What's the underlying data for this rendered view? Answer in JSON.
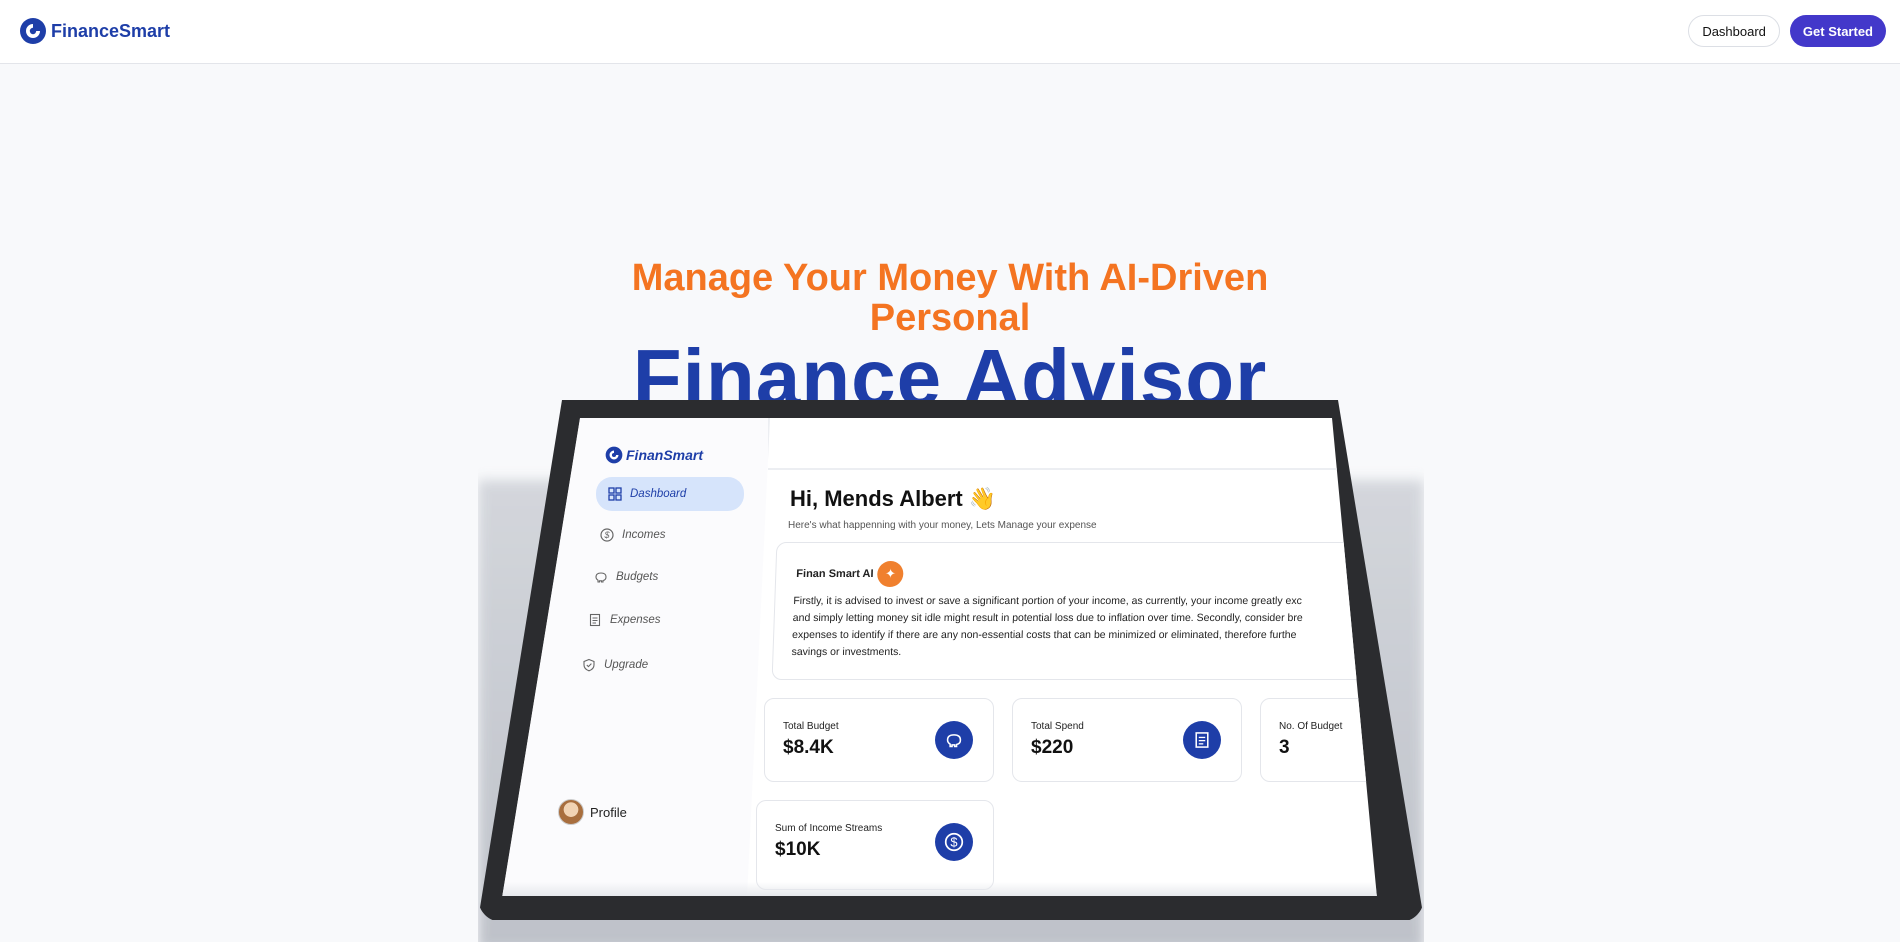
{
  "nav": {
    "brand": "FinanceSmart",
    "dashboard_label": "Dashboard",
    "get_started_label": "Get Started"
  },
  "hero": {
    "subtitle_line1": "Manage Your Money With AI-Driven",
    "subtitle_line2": "Personal",
    "title": "Finance Advisor"
  },
  "app": {
    "brand": "FinanSmart",
    "sidebar": {
      "items": [
        {
          "label": "Dashboard",
          "icon": "grid-icon",
          "active": true
        },
        {
          "label": "Incomes",
          "icon": "dollar-circle-icon",
          "active": false
        },
        {
          "label": "Budgets",
          "icon": "piggy-bank-icon",
          "active": false
        },
        {
          "label": "Expenses",
          "icon": "receipt-icon",
          "active": false
        },
        {
          "label": "Upgrade",
          "icon": "shield-check-icon",
          "active": false
        }
      ],
      "profile_label": "Profile"
    },
    "greeting": "Hi, Mends Albert 👋",
    "greeting_sub": "Here's what happenning with your money, Lets Manage your expense",
    "ai": {
      "title": "Finan Smart AI",
      "lines": [
        "Firstly, it is advised to invest or save a significant portion of your income, as currently, your income greatly exc",
        "and simply letting money sit idle might result in potential loss due to inflation over time. Secondly, consider bre",
        "expenses to identify if there are any non-essential costs that can be minimized or eliminated, therefore furthe",
        "savings or investments."
      ]
    },
    "stats": [
      {
        "label": "Total Budget",
        "value": "$8.4K",
        "icon": "piggy-bank-icon"
      },
      {
        "label": "Total Spend",
        "value": "$220",
        "icon": "receipt-icon"
      },
      {
        "label": "No. Of Budget",
        "value": "3",
        "icon": ""
      },
      {
        "label": "Sum of Income Streams",
        "value": "$10K",
        "icon": "dollar-circle-icon"
      }
    ]
  },
  "colors": {
    "brand_blue": "#1e3ea8",
    "accent_orange": "#f47421",
    "primary_button": "#4338ca",
    "ai_badge": "#f0802e"
  }
}
